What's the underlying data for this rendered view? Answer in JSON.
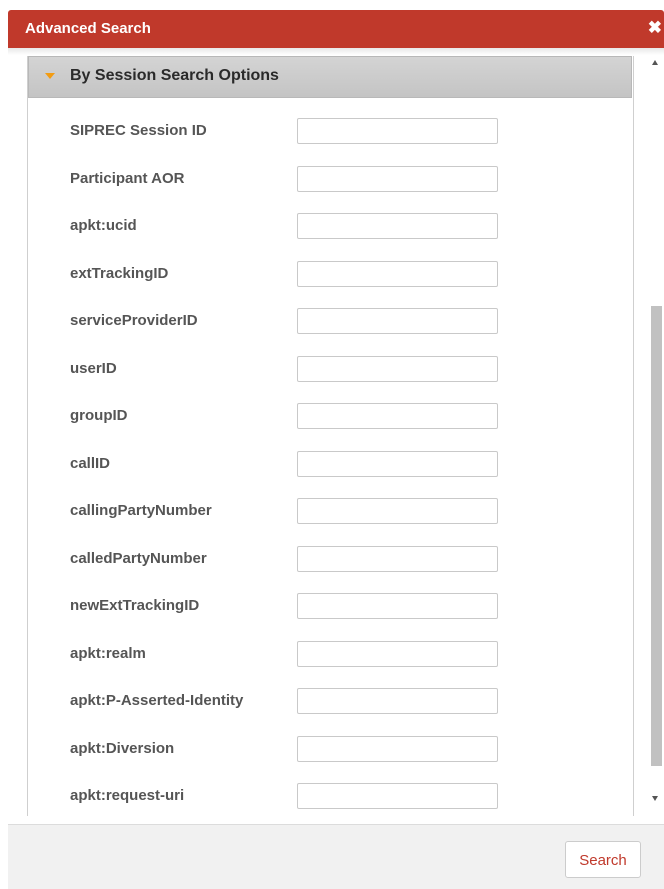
{
  "dialog": {
    "title": "Advanced Search",
    "close_glyph": "✖"
  },
  "section": {
    "title": "By Session Search Options",
    "expanded": true
  },
  "fields": [
    {
      "label": "SIPREC Session ID",
      "value": ""
    },
    {
      "label": "Participant AOR",
      "value": ""
    },
    {
      "label": "apkt:ucid",
      "value": ""
    },
    {
      "label": "extTrackingID",
      "value": ""
    },
    {
      "label": "serviceProviderID",
      "value": ""
    },
    {
      "label": "userID",
      "value": ""
    },
    {
      "label": "groupID",
      "value": ""
    },
    {
      "label": "callID",
      "value": ""
    },
    {
      "label": "callingPartyNumber",
      "value": ""
    },
    {
      "label": "calledPartyNumber",
      "value": ""
    },
    {
      "label": "newExtTrackingID",
      "value": ""
    },
    {
      "label": "apkt:realm",
      "value": ""
    },
    {
      "label": "apkt:P-Asserted-Identity",
      "value": ""
    },
    {
      "label": "apkt:Diversion",
      "value": ""
    },
    {
      "label": "apkt:request-uri",
      "value": ""
    }
  ],
  "footer": {
    "search_label": "Search"
  },
  "colors": {
    "titlebar": "#c0392b",
    "accent_arrow": "#f39c12",
    "search_text": "#c0392b"
  }
}
